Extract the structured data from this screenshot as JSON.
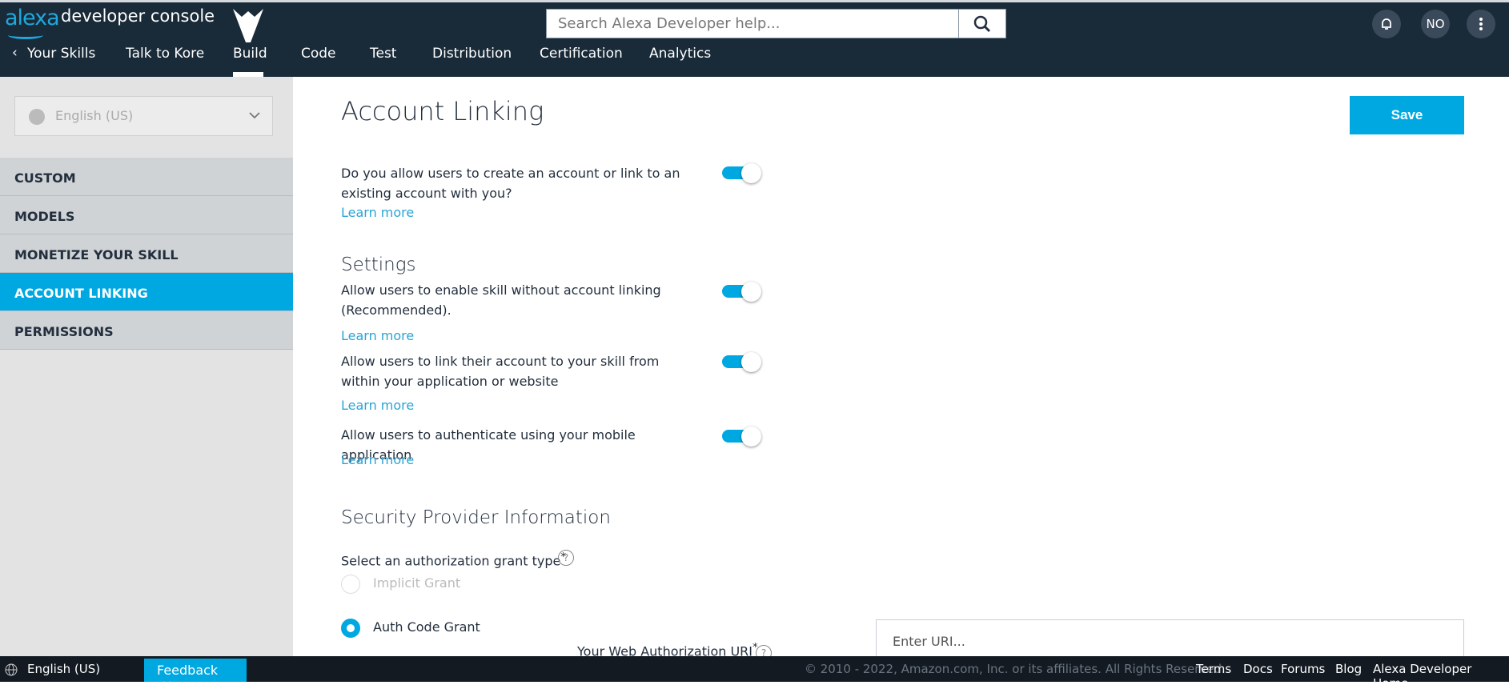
{
  "header": {
    "logo_alexa": "alexa",
    "logo_text": "developer console",
    "search_placeholder": "Search Alexa Developer help...",
    "avatar_initials": "NO",
    "nav": [
      "Your Skills",
      "Talk to Kore",
      "Build",
      "Code",
      "Test",
      "Distribution",
      "Certification",
      "Analytics"
    ],
    "active_nav": "Build"
  },
  "sidebar": {
    "language": "English (US)",
    "items": [
      "CUSTOM",
      "MODELS",
      "MONETIZE YOUR SKILL",
      "ACCOUNT LINKING",
      "PERMISSIONS"
    ],
    "active": "ACCOUNT LINKING"
  },
  "main": {
    "title": "Account Linking",
    "save_label": "Save",
    "question": "Do you allow users to create an account or link to an existing account with you?",
    "learn_more": "Learn more",
    "settings_heading": "Settings",
    "settings": [
      {
        "label": "Allow users to enable skill without account linking (Recommended).",
        "enabled": true
      },
      {
        "label": "Allow users to link their account to your skill from within your application or website",
        "enabled": true
      },
      {
        "label": "Allow users to authenticate using your mobile application",
        "enabled": true
      }
    ],
    "question_enabled": true,
    "security_heading": "Security Provider Information",
    "grant_label": "Select an authorization grant type",
    "required_mark": "*",
    "help": "?",
    "grants": [
      "Implicit Grant",
      "Auth Code Grant"
    ],
    "selected_grant": "Auth Code Grant",
    "uri_label": "Your Web Authorization URI",
    "uri_placeholder": "Enter URI..."
  },
  "footer": {
    "language": "English (US)",
    "feedback": "Feedback",
    "close": "✕",
    "copyright": "© 2010 - 2022, Amazon.com, Inc. or its affiliates. All Rights Reserved.",
    "links": [
      "Terms",
      "Docs",
      "Forums",
      "Blog",
      "Alexa Developer Home"
    ]
  },
  "colors": {
    "accent": "#00a8e1",
    "header": "#192a39",
    "footer": "#131a22"
  }
}
